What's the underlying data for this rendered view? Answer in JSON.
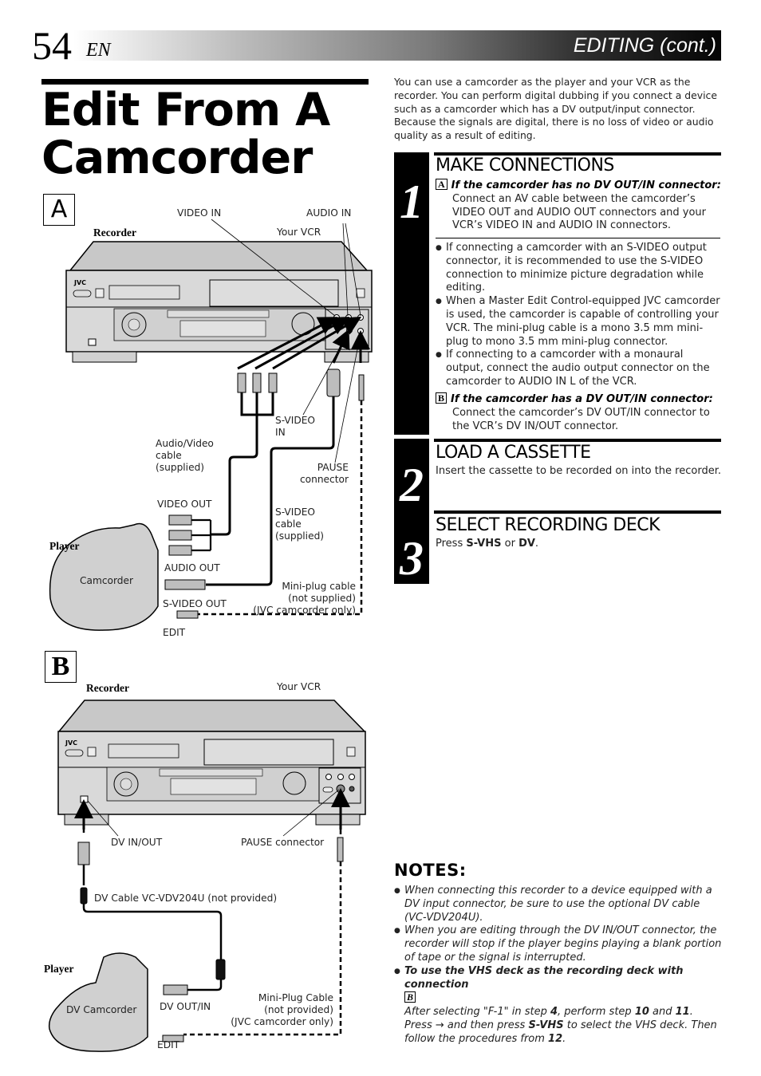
{
  "header": {
    "page_number": "54",
    "language": "EN",
    "section": "EDITING (cont.)"
  },
  "title": "Edit From A Camcorder",
  "intro": "You can use a camcorder as the player and your VCR as the recorder. You can perform digital dubbing if you connect a device such as a camcorder which has a DV output/input connector. Because the signals are digital, there is no loss of video or audio quality as a result of editing.",
  "steps": [
    {
      "number": "1",
      "heading": "MAKE CONNECTIONS",
      "case_a": {
        "badge": "A",
        "condition": "If the camcorder has no DV OUT/IN connector:",
        "text": "Connect an AV cable between the camcorder’s VIDEO OUT and AUDIO OUT connectors and your VCR’s VIDEO IN and AUDIO IN connectors."
      },
      "bullets": [
        "If connecting a camcorder with an S-VIDEO output connector, it is recommended to use the S-VIDEO connection to minimize picture degradation while editing.",
        "When a Master Edit Control-equipped JVC camcorder is used, the camcorder is capable of controlling your VCR. The mini-plug cable is a mono 3.5 mm mini-plug to mono 3.5 mm mini-plug connector.",
        "If connecting to a camcorder with a monaural output, connect the audio output connector on the camcorder to AUDIO IN L of the VCR."
      ],
      "case_b": {
        "badge": "B",
        "condition": "If the camcorder has a DV OUT/IN connector:",
        "text": "Connect the camcorder’s DV OUT/IN connector to the VCR’s DV IN/OUT connector."
      }
    },
    {
      "number": "2",
      "heading": "LOAD A CASSETTE",
      "text": "Insert the cassette to be recorded on into the recorder."
    },
    {
      "number": "3",
      "heading": "SELECT RECORDING DECK",
      "text_pre": "Press ",
      "key1": "S-VHS",
      "text_mid": " or ",
      "key2": "DV",
      "text_post": "."
    }
  ],
  "notes": {
    "heading": "NOTES:",
    "items": [
      "When connecting this recorder to a device equipped with a DV input connector, be sure to use the optional DV cable (VC-VDV204U).",
      "When you are editing through the DV IN/OUT connector, the recorder will stop if the player begins playing a blank portion of tape or the signal is interrupted."
    ],
    "item3": {
      "bold_lead": "To use the VHS deck as the recording deck with connection",
      "badge": "B",
      "p1": "After selecting \"F-1\" in step ",
      "s1": "4",
      "p2": ", perform step ",
      "s2": "10",
      "p3": " and ",
      "s3": "11",
      "p4": ". Press → and then press ",
      "s4": "S-VHS",
      "p5": " to select the VHS deck. Then follow the procedures from ",
      "s5": "12",
      "p6": "."
    }
  },
  "diagram_a": {
    "badge": "A",
    "recorder": "Recorder",
    "your_vcr": "Your VCR",
    "brand": "JVC",
    "video_in": "VIDEO IN",
    "audio_in": "AUDIO IN",
    "s_video_in": [
      "S-VIDEO",
      "IN"
    ],
    "av_cable": [
      "Audio/Video",
      "cable",
      "(supplied)"
    ],
    "pause_connector": [
      "PAUSE",
      "connector"
    ],
    "video_out": "VIDEO OUT",
    "s_video_cable": [
      "S-VIDEO",
      "cable",
      "(supplied)"
    ],
    "player": "Player",
    "camcorder": "Camcorder",
    "audio_out": "AUDIO OUT",
    "mini_plug": [
      "Mini-plug cable",
      "(not supplied)",
      "(JVC camcorder only)"
    ],
    "s_video_out": "S-VIDEO OUT",
    "edit": "EDIT"
  },
  "diagram_b": {
    "badge": "B",
    "recorder": "Recorder",
    "your_vcr": "Your VCR",
    "brand": "JVC",
    "dv_in_out": "DV IN/OUT",
    "pause_connector": "PAUSE connector",
    "dv_cable": "DV Cable VC-VDV204U (not provided)",
    "player": "Player",
    "dv_camcorder": "DV Camcorder",
    "dv_out_in": "DV OUT/IN",
    "mini_plug": [
      "Mini-Plug Cable",
      "(not provided)",
      "(JVC camcorder only)"
    ],
    "edit": "EDIT"
  },
  "colors": {
    "device_fill": "#d6d6d6",
    "device_top": "#c4c4c4",
    "ink": "#000000"
  }
}
